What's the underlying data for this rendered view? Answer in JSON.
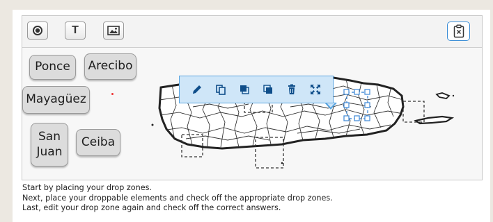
{
  "toolbar": {
    "tools": [
      {
        "name": "target-tool",
        "icon": "target-icon"
      },
      {
        "name": "text-tool",
        "label": "T",
        "icon": "text-icon"
      },
      {
        "name": "image-tool",
        "icon": "image-icon"
      }
    ],
    "clipboard_icon": "clipboard-clear-icon",
    "accent": "#3a8dd6"
  },
  "floating_toolbar": {
    "icons": [
      "pencil-icon",
      "copy-icon",
      "bring-front-icon",
      "send-back-icon",
      "trash-icon",
      "expand-icon"
    ],
    "background": "#cfe6f8",
    "border": "#59a4e0"
  },
  "draggables": [
    {
      "label": "Ponce"
    },
    {
      "label": "Arecibo"
    },
    {
      "label": "Mayagüez"
    },
    {
      "label": "San Juan",
      "lines": [
        "San",
        "Juan"
      ]
    },
    {
      "label": "Ceiba"
    }
  ],
  "instructions": [
    "Start by placing your drop zones.",
    "Next, place your droppable elements and check off the appropriate drop zones.",
    "Last, edit your drop zone again and check off the correct answers."
  ]
}
